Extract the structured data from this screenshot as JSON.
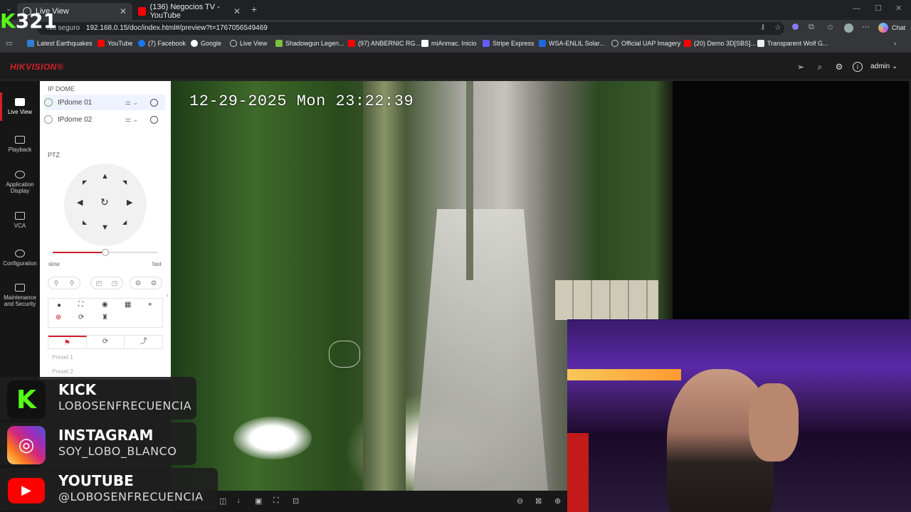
{
  "browser": {
    "tabs": [
      {
        "label": "Live View",
        "active": true
      },
      {
        "label": "(136) Negocios TV - YouTube",
        "active": false
      }
    ],
    "url_prefix": "No seguro",
    "url": "192.168.0.15/doc/index.html#/preview?t=1767056549469",
    "chat_label": "Chat",
    "bookmarks": [
      "Latest Earthquakes",
      "YouTube",
      "(7) Facebook",
      "Google",
      "Live View",
      "Shadowgun Legen...",
      "(97) ANBERNIC RG...",
      "miAnmac. Inicio",
      "Stripe Express",
      "WSA-ENLIL Solar...",
      "Official UAP Imagery",
      "(20) Demo 3D[SBS]...",
      "Transparent Wolf G..."
    ]
  },
  "hik": {
    "logo": "HIKVISION®",
    "user": "admin",
    "nav": [
      "Live View",
      "Playback",
      "Application Display",
      "VCA",
      "Configuration",
      "Maintenance and Security"
    ],
    "group_title": "IP DOME",
    "cameras": [
      "IPdome 01",
      "IPdome 02"
    ],
    "ptz_title": "PTZ",
    "slow": "slow",
    "fast": "fast",
    "presets": [
      "Preset 1",
      "Preset 2"
    ],
    "speed_fraction": 0.5
  },
  "video": {
    "osd": "12-29-2025 Mon 23:22:39"
  },
  "overlay": {
    "counter_k": "K",
    "counter_num": "321",
    "socials": [
      {
        "name": "KICK",
        "handle": "LOBOSENFRECUENCIA",
        "color": "#53fc18"
      },
      {
        "name": "INSTAGRAM",
        "handle": "SOY_LOBO_BLANCO",
        "color": "#d62976"
      },
      {
        "name": "YOUTUBE",
        "handle": "@LOBOSENFRECUENCIA",
        "color": "#ff0000"
      }
    ]
  },
  "colors": {
    "hik_red": "#d3202b",
    "kick_green": "#53fc18"
  }
}
